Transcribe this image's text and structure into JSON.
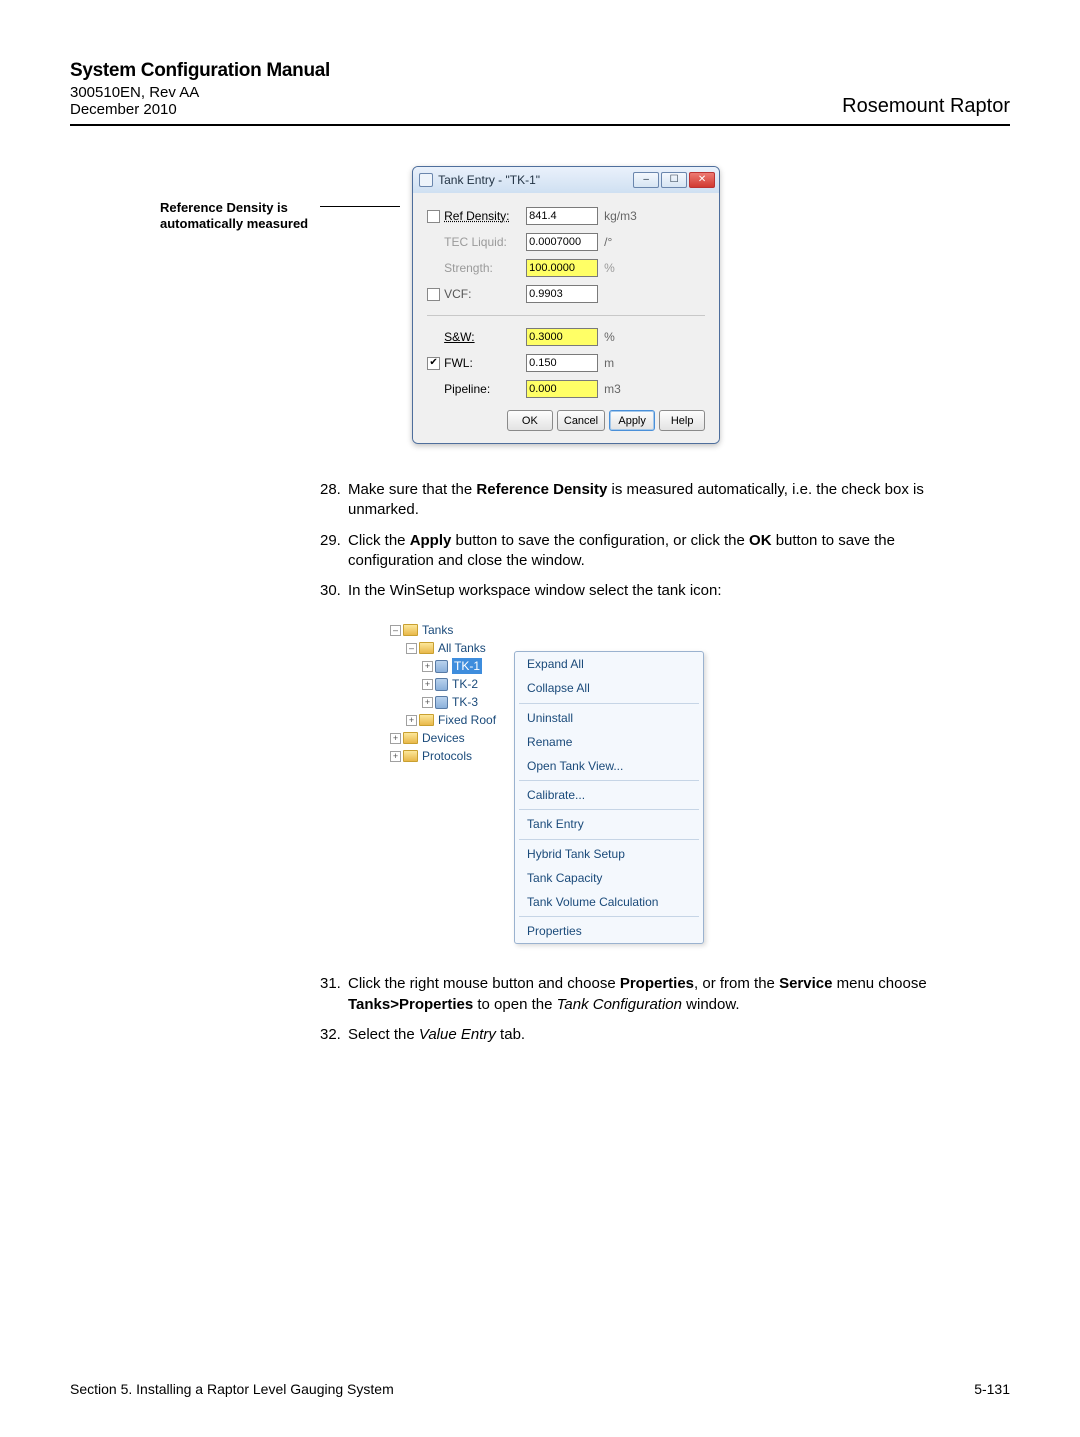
{
  "header": {
    "manual_title": "System Configuration Manual",
    "doc_id": "300510EN, Rev AA",
    "doc_date": "December 2010",
    "product": "Rosemount Raptor"
  },
  "callout": "Reference Density is\nautomatically measured",
  "dialog": {
    "title": "Tank Entry -  \"TK-1\"",
    "rows": {
      "ref_density": {
        "label": "Ref Density:",
        "value": "841.4",
        "unit": "kg/m3"
      },
      "tec_liquid": {
        "label": "TEC Liquid:",
        "value": "0.0007000",
        "unit": "/°"
      },
      "strength": {
        "label": "Strength:",
        "value": "100.0000",
        "unit": "%"
      },
      "vcf": {
        "label": "VCF:",
        "value": "0.9903",
        "unit": ""
      },
      "sw": {
        "label": "S&W:",
        "value": "0.3000",
        "unit": "%"
      },
      "fwl": {
        "label": "FWL:",
        "value": "0.150",
        "unit": "m"
      },
      "pipeline": {
        "label": "Pipeline:",
        "value": "0.000",
        "unit": "m3"
      }
    },
    "buttons": {
      "ok": "OK",
      "cancel": "Cancel",
      "apply": "Apply",
      "help": "Help"
    }
  },
  "steps": {
    "s28": "Make sure that the <b>Reference Density</b> is measured automatically, i.e. the check box is unmarked.",
    "s29": "Click the <b>Apply</b> button to save the configuration, or click the <b>OK</b> button to save the configuration and close the window.",
    "s30": "In the WinSetup workspace window select the tank icon:",
    "s31": "Click the right mouse button and choose <b>Properties</b>, or from the <b>Service</b> menu choose <b>Tanks>Properties</b> to open the <i>Tank Configuration</i> window.",
    "s32": "Select the <i>Value Entry</i> tab."
  },
  "tree": {
    "tanks": "Tanks",
    "all_tanks": "All Tanks",
    "tk1": "TK-1",
    "tk2": "TK-2",
    "tk3": "TK-3",
    "fixed_roof": "Fixed Roof",
    "devices": "Devices",
    "protocols": "Protocols"
  },
  "context_menu": {
    "expand_all": "Expand All",
    "collapse_all": "Collapse All",
    "uninstall": "Uninstall",
    "rename": "Rename",
    "open_tank_view": "Open Tank View...",
    "calibrate": "Calibrate...",
    "tank_entry": "Tank Entry",
    "hybrid": "Hybrid Tank Setup",
    "tank_capacity": "Tank Capacity",
    "tank_volume": "Tank Volume Calculation",
    "properties": "Properties"
  },
  "footer": {
    "left": "Section 5. Installing a Raptor Level Gauging System",
    "right": "5-131"
  }
}
